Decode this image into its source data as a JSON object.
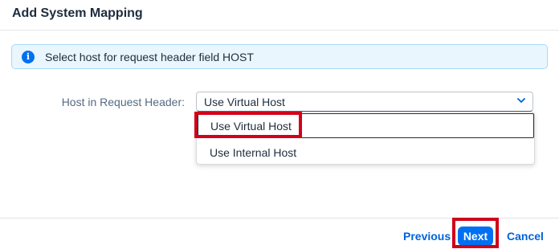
{
  "dialog": {
    "title": "Add System Mapping"
  },
  "info": {
    "icon": "info-icon",
    "message": "Select host for request header field HOST"
  },
  "field": {
    "label": "Host in Request Header:",
    "selected_value": "Use Virtual Host",
    "chevron_icon": "chevron-down-icon"
  },
  "dropdown": {
    "options": [
      {
        "label": "Use Virtual Host"
      },
      {
        "label": "Use Internal Host"
      }
    ]
  },
  "footer": {
    "previous_label": "Previous",
    "next_label": "Next",
    "cancel_label": "Cancel"
  },
  "colors": {
    "accent": "#0070f2",
    "link": "#0064d9",
    "info_background": "#eaf6fd",
    "highlight": "#d0021b"
  }
}
